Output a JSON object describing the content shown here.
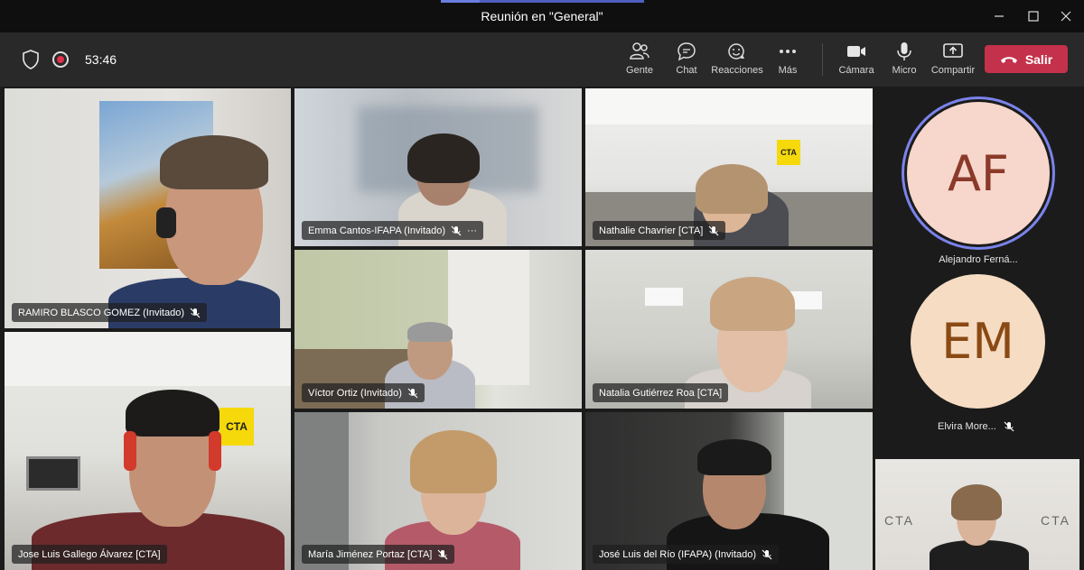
{
  "window": {
    "title": "Reunión en \"General\""
  },
  "toolbar": {
    "timer": "53:46",
    "people_label": "Gente",
    "chat_label": "Chat",
    "reactions_label": "Reacciones",
    "more_label": "Más",
    "camera_label": "Cámara",
    "mic_label": "Micro",
    "share_label": "Compartir",
    "leave_label": "Salir",
    "leave_color": "#c4314b"
  },
  "participants": [
    {
      "name": "RAMIRO BLASCO GOMEZ (Invitado)",
      "muted": true
    },
    {
      "name": "Emma Cantos-IFAPA (Invitado)",
      "muted": true,
      "more": "···"
    },
    {
      "name": "Nathalie Chavrier [CTA]",
      "muted": true
    },
    {
      "name": "Víctor Ortiz (Invitado)",
      "muted": true
    },
    {
      "name": "Natalia Gutiérrez Roa [CTA]",
      "muted": false
    },
    {
      "name": "Jose Luis Gallego Álvarez [CTA]",
      "muted": false
    },
    {
      "name": "María Jiménez Portaz [CTA]",
      "muted": true
    },
    {
      "name": "José Luis del Río (IFAPA) (Invitado)",
      "muted": true
    }
  ],
  "roster": [
    {
      "initials": "AF",
      "name": "Alejandro Ferná...",
      "muted": false,
      "bg": "#f7d7cc",
      "fg": "#8b3a2a",
      "ring": "#7b83eb"
    },
    {
      "initials": "EM",
      "name": "Elvira More...",
      "muted": true,
      "bg": "#f6dcc3",
      "fg": "#8a4a14"
    }
  ],
  "self_view": {
    "logo_left": "CTA",
    "logo_right": "CTA"
  },
  "wall_logo": "CTA"
}
